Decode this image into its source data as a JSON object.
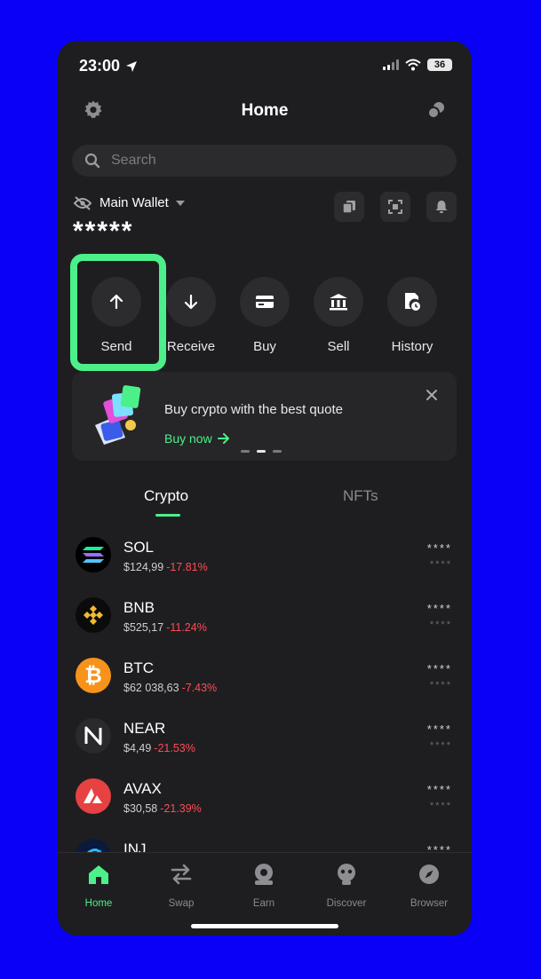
{
  "status": {
    "time": "23:00",
    "battery": "36"
  },
  "header": {
    "title": "Home"
  },
  "search": {
    "placeholder": "Search"
  },
  "wallet": {
    "name": "Main Wallet",
    "balance": "*****"
  },
  "actions": [
    {
      "label": "Send"
    },
    {
      "label": "Receive"
    },
    {
      "label": "Buy"
    },
    {
      "label": "Sell"
    },
    {
      "label": "History"
    }
  ],
  "banner": {
    "text": "Buy crypto with the best quote",
    "link": "Buy now"
  },
  "tabs": [
    {
      "label": "Crypto"
    },
    {
      "label": "NFTs"
    }
  ],
  "assets": [
    {
      "symbol": "SOL",
      "price": "$124,99",
      "change": "-17.81%",
      "hidden_amount": "****",
      "hidden_value": "****"
    },
    {
      "symbol": "BNB",
      "price": "$525,17",
      "change": "-11.24%",
      "hidden_amount": "****",
      "hidden_value": "****"
    },
    {
      "symbol": "BTC",
      "price": "$62 038,63",
      "change": "-7.43%",
      "hidden_amount": "****",
      "hidden_value": "****"
    },
    {
      "symbol": "NEAR",
      "price": "$4,49",
      "change": "-21.53%",
      "hidden_amount": "****",
      "hidden_value": "****"
    },
    {
      "symbol": "AVAX",
      "price": "$30,58",
      "change": "-21.39%",
      "hidden_amount": "****",
      "hidden_value": "****"
    },
    {
      "symbol": "INJ",
      "price": "",
      "change": "",
      "hidden_amount": "****",
      "hidden_value": ""
    }
  ],
  "bottom_nav": [
    {
      "label": "Home",
      "icon": "home-icon"
    },
    {
      "label": "Swap",
      "icon": "swap-icon"
    },
    {
      "label": "Earn",
      "icon": "earn-icon"
    },
    {
      "label": "Discover",
      "icon": "discover-icon"
    },
    {
      "label": "Browser",
      "icon": "compass-icon"
    }
  ],
  "colors": {
    "accent": "#4cf08a",
    "negative": "#ff4b55",
    "background": "#1e1e20",
    "frame": "#0a00f5"
  }
}
